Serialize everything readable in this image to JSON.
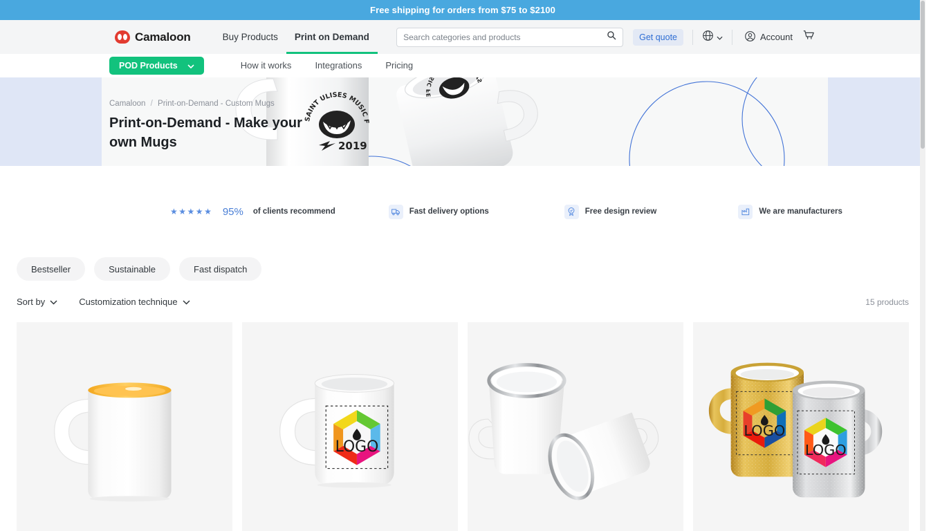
{
  "promo": {
    "text": "Free shipping for orders from $75 to $2100"
  },
  "header": {
    "brand": "Camaloon",
    "nav": [
      {
        "label": "Buy Products",
        "active": false
      },
      {
        "label": "Print on Demand",
        "active": true
      }
    ],
    "search": {
      "placeholder": "Search categories and products",
      "value": ""
    },
    "quote_label": "Get quote",
    "account_label": "Account",
    "icons": {
      "search": "search-icon",
      "globe": "globe-icon",
      "chevron": "chevron-down-icon",
      "account": "account-icon",
      "cart": "cart-icon"
    }
  },
  "subnav": {
    "pod_button": "POD Products",
    "links": [
      "How it works",
      "Integrations",
      "Pricing"
    ],
    "accent": "#12c27d"
  },
  "hero": {
    "breadcrumb": [
      "Camaloon",
      "Print-on-Demand - Custom Mugs"
    ],
    "separator": "/",
    "title": "Print-on-Demand - Make your own Mugs",
    "bg_outer": "#dfe6f6",
    "bg_inner": "#f7f8f8",
    "mug_caption_top": "SAINT ULISES MUSIC FESTIVAL",
    "mug_caption_year": "2019"
  },
  "trust": {
    "rating_stars": 5,
    "rating_filled": 4.5,
    "percent": "95%",
    "percent_label": "of clients recommend",
    "items": [
      {
        "label": "Fast delivery options",
        "icon": "truck-icon"
      },
      {
        "label": "Free design review",
        "icon": "badge-check-icon"
      },
      {
        "label": "We are manufacturers",
        "icon": "factory-icon"
      }
    ]
  },
  "filters": {
    "chips": [
      "Bestseller",
      "Sustainable",
      "Fast dispatch"
    ],
    "sort_label": "Sort by",
    "technique_label": "Customization technique",
    "product_count": "15 products"
  },
  "products": [
    {
      "name": "white-mug-yellow-inside",
      "bg": "#f5f5f5"
    },
    {
      "name": "white-ceramic-mug-with-logo-print",
      "bg": "#f5f5f5"
    },
    {
      "name": "white-enamel-mug-pair",
      "bg": "#f5f5f5"
    },
    {
      "name": "gold-and-silver-glitter-mugs",
      "bg": "#f5f5f5"
    }
  ]
}
